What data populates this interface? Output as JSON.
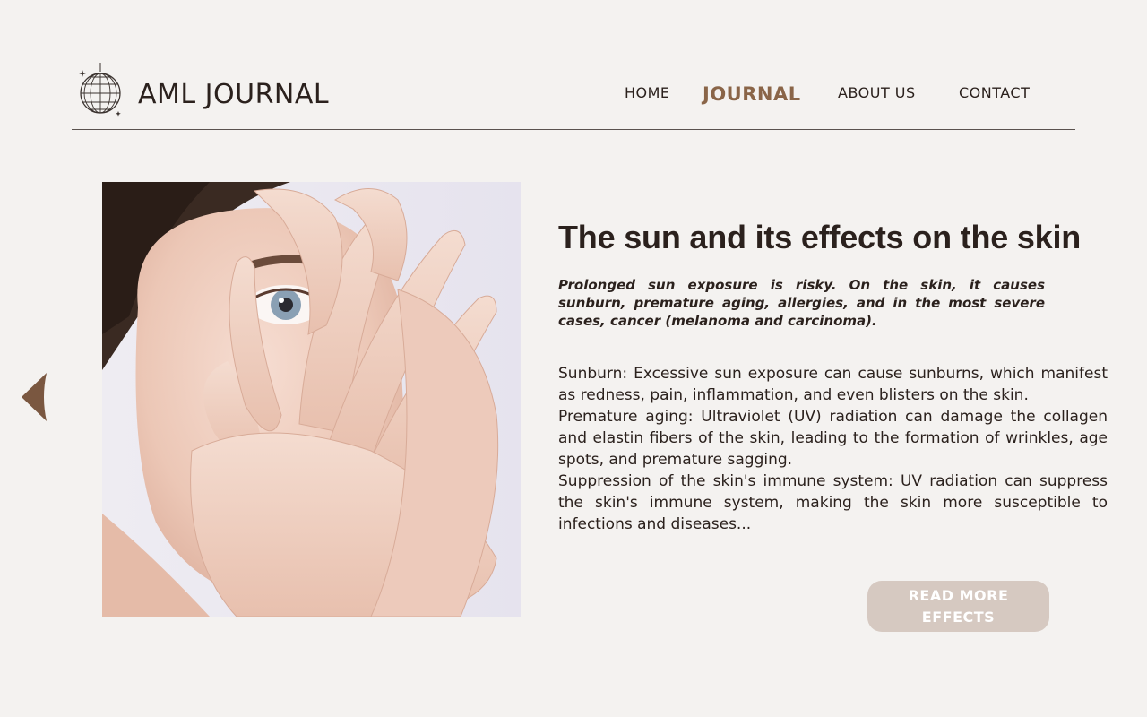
{
  "header": {
    "brand": "AML JOURNAL",
    "logo_icon": "disco-ball-icon",
    "nav": {
      "home": "HOME",
      "journal": "JOURNAL",
      "about": "ABOUT US",
      "contact": "CONTACT"
    },
    "active_nav": "journal"
  },
  "carousel": {
    "prev_icon": "chevron-left-icon"
  },
  "article": {
    "image_alt": "woman-covering-face-with-hands",
    "title": "The sun and its effects on the skin",
    "intro": "Prolonged sun exposure is risky. On the skin, it causes sunburn, premature aging, allergies, and in the most severe cases, cancer (melanoma and carcinoma).",
    "paragraphs": [
      "Sunburn: Excessive sun exposure can cause sunburns, which manifest as redness, pain, inflammation, and even blisters on the skin.",
      "Premature aging: Ultraviolet (UV) radiation can damage the collagen and elastin fibers of the skin, leading to the formation of wrinkles, age spots, and premature sagging.",
      "Suppression of the skin's immune system: UV radiation can suppress the skin's immune system, making the skin more susceptible to infections and diseases..."
    ],
    "read_more_label": "READ MORE EFFECTS"
  },
  "colors": {
    "background": "#f4f2f0",
    "text": "#2b211d",
    "accent": "#8a6548",
    "button": "#d6c9c1"
  }
}
